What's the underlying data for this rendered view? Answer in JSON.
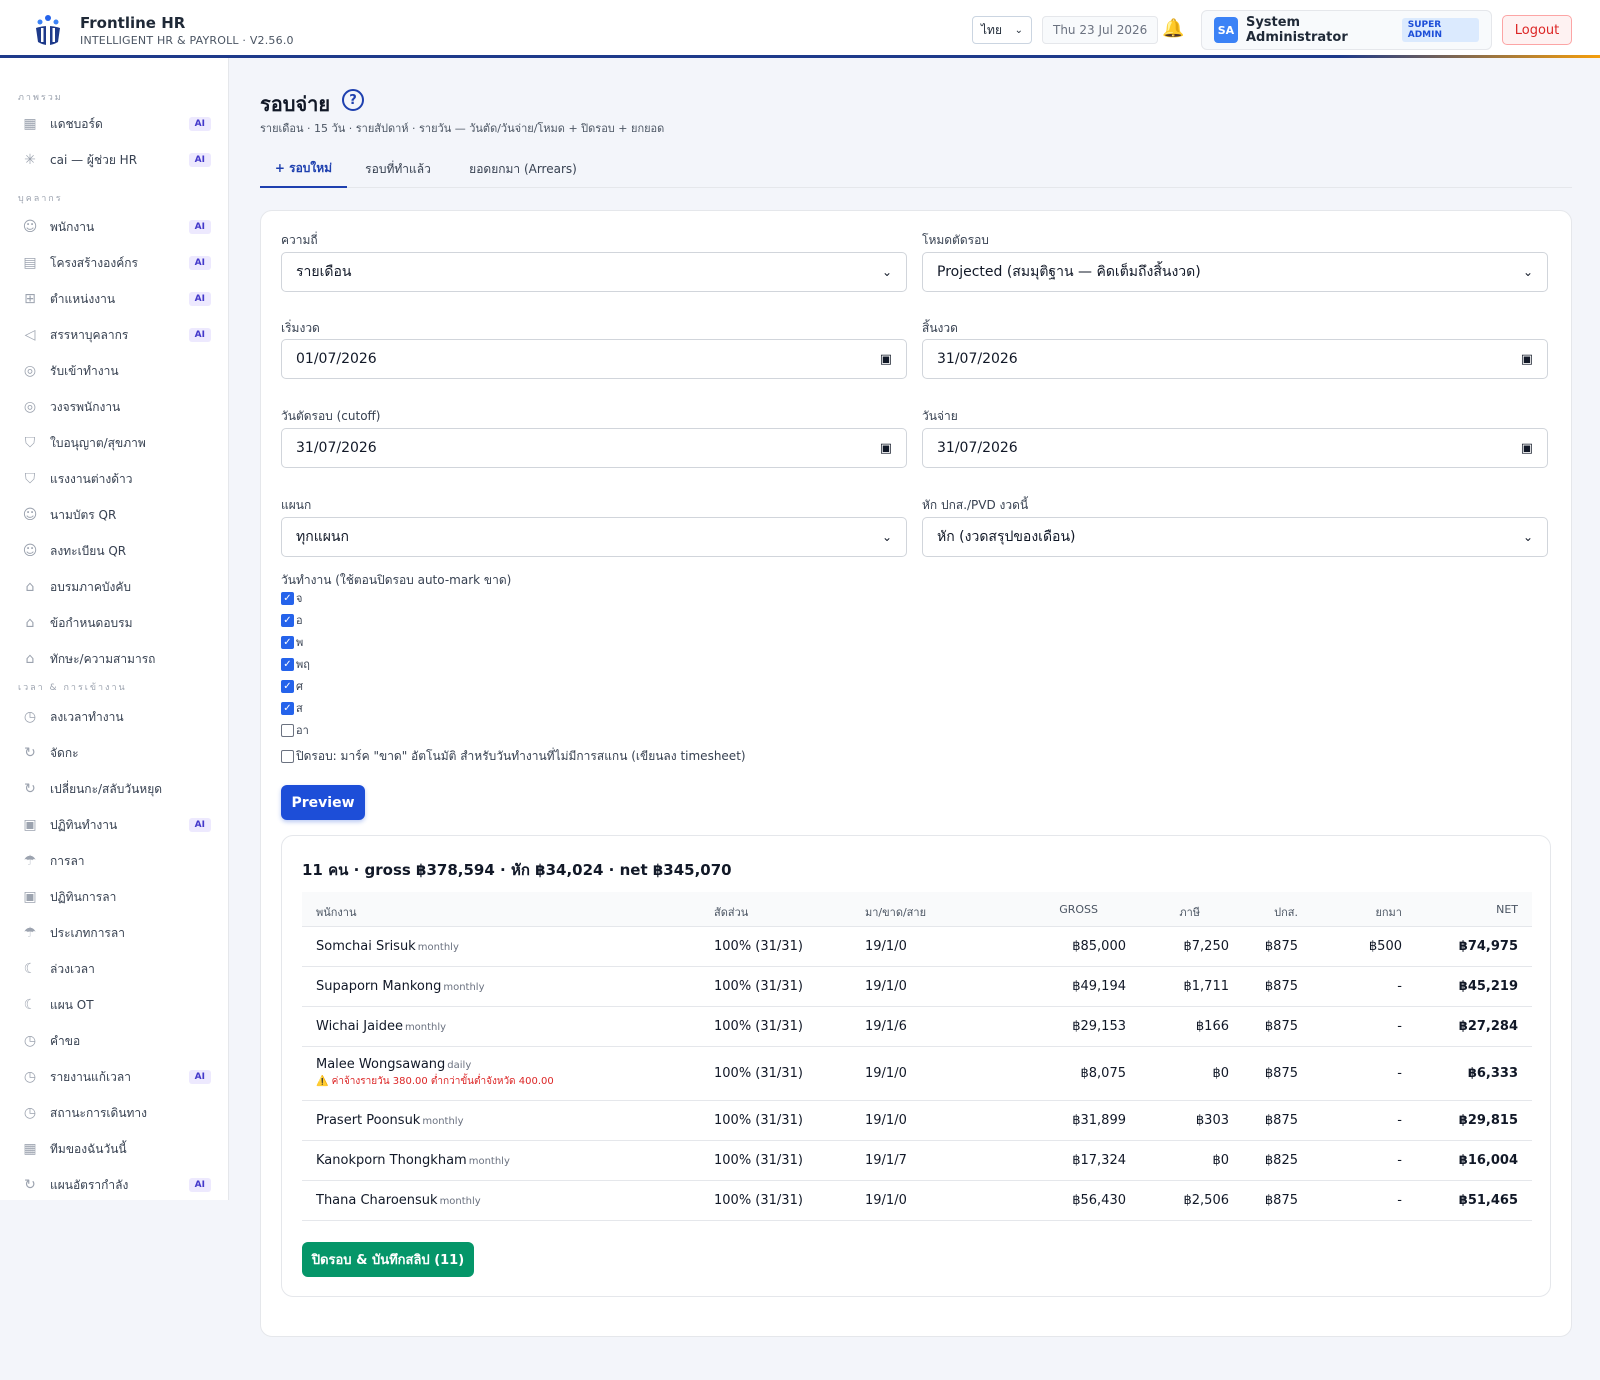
{
  "header": {
    "title": "Frontline HR",
    "subtitle": "INTELLIGENT HR & PAYROLL · V2.56.0",
    "language": "ไทย",
    "date": "Thu 23 Jul 2026",
    "user_initials": "SA",
    "user_name": "System Administrator",
    "role_badge": "SUPER ADMIN",
    "logout_label": "Logout"
  },
  "sidebar": {
    "sections": [
      "ภาพรวม",
      "บุคลากร",
      "เวลา & การเข้างาน"
    ],
    "items": [
      {
        "label": "แดชบอร์ด",
        "icon": "grid-icon",
        "ai": "AI"
      },
      {
        "label": "cai — ผู้ช่วย HR",
        "icon": "sparkle-icon",
        "ai": "AI"
      },
      {
        "label": "พนักงาน",
        "icon": "users-icon",
        "ai": "AI"
      },
      {
        "label": "โครงสร้างองค์กร",
        "icon": "building-icon",
        "ai": "AI"
      },
      {
        "label": "ตำแหน่งงาน",
        "icon": "org-chart-icon",
        "ai": "AI"
      },
      {
        "label": "สรรหาบุคลากร",
        "icon": "megaphone-icon",
        "ai": "AI"
      },
      {
        "label": "รับเข้าทำงาน",
        "icon": "compass-icon",
        "ai": ""
      },
      {
        "label": "วงจรพนักงาน",
        "icon": "compass-icon",
        "ai": ""
      },
      {
        "label": "ใบอนุญาต/สุขภาพ",
        "icon": "shield-icon",
        "ai": ""
      },
      {
        "label": "แรงงานต่างด้าว",
        "icon": "shield-icon",
        "ai": ""
      },
      {
        "label": "นามบัตร QR",
        "icon": "users-icon",
        "ai": ""
      },
      {
        "label": "ลงทะเบียน QR",
        "icon": "users-icon",
        "ai": ""
      },
      {
        "label": "อบรมภาคบังคับ",
        "icon": "graduation-icon",
        "ai": ""
      },
      {
        "label": "ข้อกำหนดอบรม",
        "icon": "graduation-icon",
        "ai": ""
      },
      {
        "label": "ทักษะ/ความสามารถ",
        "icon": "graduation-icon",
        "ai": ""
      },
      {
        "label": "ลงเวลาทำงาน",
        "icon": "clock-icon",
        "ai": ""
      },
      {
        "label": "จัดกะ",
        "icon": "refresh-icon",
        "ai": ""
      },
      {
        "label": "เปลี่ยนกะ/สลับวันหยุด",
        "icon": "refresh-icon",
        "ai": ""
      },
      {
        "label": "ปฏิทินทำงาน",
        "icon": "calendar-icon",
        "ai": "AI"
      },
      {
        "label": "การลา",
        "icon": "umbrella-icon",
        "ai": ""
      },
      {
        "label": "ปฏิทินการลา",
        "icon": "calendar-icon",
        "ai": ""
      },
      {
        "label": "ประเภทการลา",
        "icon": "umbrella-icon",
        "ai": ""
      },
      {
        "label": "ล่วงเวลา",
        "icon": "moon-icon",
        "ai": ""
      },
      {
        "label": "แผน OT",
        "icon": "moon-icon",
        "ai": ""
      },
      {
        "label": "คำขอ",
        "icon": "clock-icon",
        "ai": ""
      },
      {
        "label": "รายงานแก้เวลา",
        "icon": "clock-icon",
        "ai": "AI"
      },
      {
        "label": "สถานะการเดินทาง",
        "icon": "clock-icon",
        "ai": ""
      },
      {
        "label": "ทีมของฉันวันนี้",
        "icon": "grid-icon",
        "ai": ""
      },
      {
        "label": "แผนอัตรากำลัง",
        "icon": "refresh-icon",
        "ai": "AI"
      }
    ]
  },
  "page": {
    "title": "รอบจ่าย",
    "help": "?",
    "subtitle": "รายเดือน · 15 วัน · รายสัปดาห์ · รายวัน — วันตัด/วันจ่าย/โหมด + ปิดรอบ + ยกยอด",
    "tabs": [
      "+ รอบใหม่",
      "รอบที่ทำแล้ว",
      "ยอดยกมา (Arrears)"
    ]
  },
  "form": {
    "frequency": {
      "label": "ความถี่",
      "value": "รายเดือน"
    },
    "cutoff_mode": {
      "label": "โหมดตัดรอบ",
      "value": "Projected (สมมุติฐาน — คิดเต็มถึงสิ้นงวด)"
    },
    "period_start": {
      "label": "เริ่มงวด",
      "value": "01/07/2026"
    },
    "period_end": {
      "label": "สิ้นงวด",
      "value": "31/07/2026"
    },
    "cutoff_date": {
      "label": "วันตัดรอบ (cutoff)",
      "value": "31/07/2026"
    },
    "pay_date": {
      "label": "วันจ่าย",
      "value": "31/07/2026"
    },
    "department": {
      "label": "แผนก",
      "value": "ทุกแผนก"
    },
    "deduction": {
      "label": "หัก ปกส./PVD งวดนี้",
      "value": "หัก (งวดสรุปของเดือน)"
    },
    "workdays_label": "วันทำงาน (ใช้ตอนปิดรอบ auto-mark ขาด)",
    "workdays": [
      {
        "label": "จ",
        "checked": true
      },
      {
        "label": "อ",
        "checked": true
      },
      {
        "label": "พ",
        "checked": true
      },
      {
        "label": "พฤ",
        "checked": true
      },
      {
        "label": "ศ",
        "checked": true
      },
      {
        "label": "ส",
        "checked": true
      },
      {
        "label": "อา",
        "checked": false
      }
    ],
    "close_option": "ปิดรอบ: มาร์ค \"ขาด\" อัตโนมัติ สำหรับวันทำงานที่ไม่มีการสแกน (เขียนลง timesheet)",
    "preview_label": "Preview"
  },
  "results": {
    "summary": "11 คน · gross ฿378,594 · หัก ฿34,024 · net ฿345,070",
    "columns": [
      "พนักงาน",
      "สัดส่วน",
      "มา/ขาด/สาย",
      "GROSS",
      "ภาษี",
      "ปกส.",
      "ยกมา",
      "NET"
    ],
    "rows": [
      {
        "name": "Somchai Srisuk",
        "type": "monthly",
        "warning": "",
        "ratio": "100% (31/31)",
        "attendance": "19/1/0",
        "gross": "฿85,000",
        "tax": "฿7,250",
        "sso": "฿875",
        "carry": "฿500",
        "net": "฿74,975"
      },
      {
        "name": "Supaporn Mankong",
        "type": "monthly",
        "warning": "",
        "ratio": "100% (31/31)",
        "attendance": "19/1/0",
        "gross": "฿49,194",
        "tax": "฿1,711",
        "sso": "฿875",
        "carry": "-",
        "net": "฿45,219"
      },
      {
        "name": "Wichai Jaidee",
        "type": "monthly",
        "warning": "",
        "ratio": "100% (31/31)",
        "attendance": "19/1/6",
        "gross": "฿29,153",
        "tax": "฿166",
        "sso": "฿875",
        "carry": "-",
        "net": "฿27,284"
      },
      {
        "name": "Malee Wongsawang",
        "type": "daily",
        "warning": "⚠️ ค่าจ้างรายวัน 380.00 ต่ำกว่าขั้นต่ำจังหวัด 400.00",
        "ratio": "100% (31/31)",
        "attendance": "19/1/0",
        "gross": "฿8,075",
        "tax": "฿0",
        "sso": "฿875",
        "carry": "-",
        "net": "฿6,333"
      },
      {
        "name": "Prasert Poonsuk",
        "type": "monthly",
        "warning": "",
        "ratio": "100% (31/31)",
        "attendance": "19/1/0",
        "gross": "฿31,899",
        "tax": "฿303",
        "sso": "฿875",
        "carry": "-",
        "net": "฿29,815"
      },
      {
        "name": "Kanokporn Thongkham",
        "type": "monthly",
        "warning": "",
        "ratio": "100% (31/31)",
        "attendance": "19/1/7",
        "gross": "฿17,324",
        "tax": "฿0",
        "sso": "฿825",
        "carry": "-",
        "net": "฿16,004"
      },
      {
        "name": "Thana Charoensuk",
        "type": "monthly",
        "warning": "",
        "ratio": "100% (31/31)",
        "attendance": "19/1/0",
        "gross": "฿56,430",
        "tax": "฿2,506",
        "sso": "฿875",
        "carry": "-",
        "net": "฿51,465"
      }
    ],
    "save_label": "ปิดรอบ & บันทึกสลิป (11)"
  }
}
